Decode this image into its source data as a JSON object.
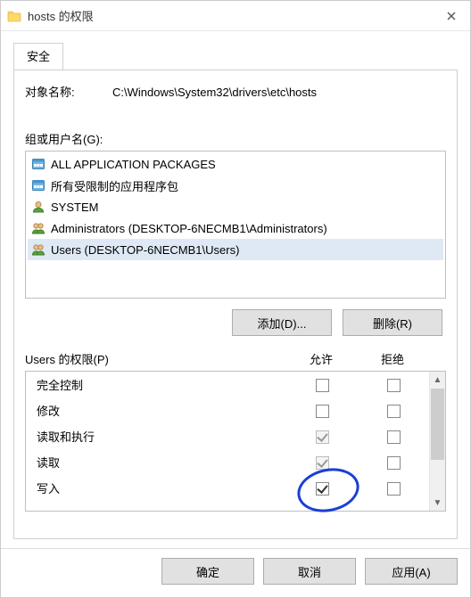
{
  "window": {
    "title": "hosts 的权限"
  },
  "tab": {
    "security": "安全"
  },
  "object": {
    "label": "对象名称:",
    "path": "C:\\Windows\\System32\\drivers\\etc\\hosts"
  },
  "groups": {
    "label": "组或用户名(G):",
    "items": [
      {
        "name": "ALL APPLICATION PACKAGES",
        "icon": "package"
      },
      {
        "name": "所有受限制的应用程序包",
        "icon": "package"
      },
      {
        "name": "SYSTEM",
        "icon": "user"
      },
      {
        "name": "Administrators (DESKTOP-6NECMB1\\Administrators)",
        "icon": "group"
      },
      {
        "name": "Users (DESKTOP-6NECMB1\\Users)",
        "icon": "group"
      }
    ]
  },
  "buttons": {
    "add": "添加(D)...",
    "remove": "删除(R)",
    "ok": "确定",
    "cancel": "取消",
    "apply": "应用(A)"
  },
  "perms": {
    "title": "Users 的权限(P)",
    "allow": "允许",
    "deny": "拒绝",
    "rows": [
      {
        "name": "完全控制",
        "allow": false,
        "deny": false,
        "ro": false
      },
      {
        "name": "修改",
        "allow": false,
        "deny": false,
        "ro": false
      },
      {
        "name": "读取和执行",
        "allow": true,
        "deny": false,
        "ro": true
      },
      {
        "name": "读取",
        "allow": true,
        "deny": false,
        "ro": true
      },
      {
        "name": "写入",
        "allow": true,
        "deny": false,
        "ro": false
      }
    ]
  }
}
